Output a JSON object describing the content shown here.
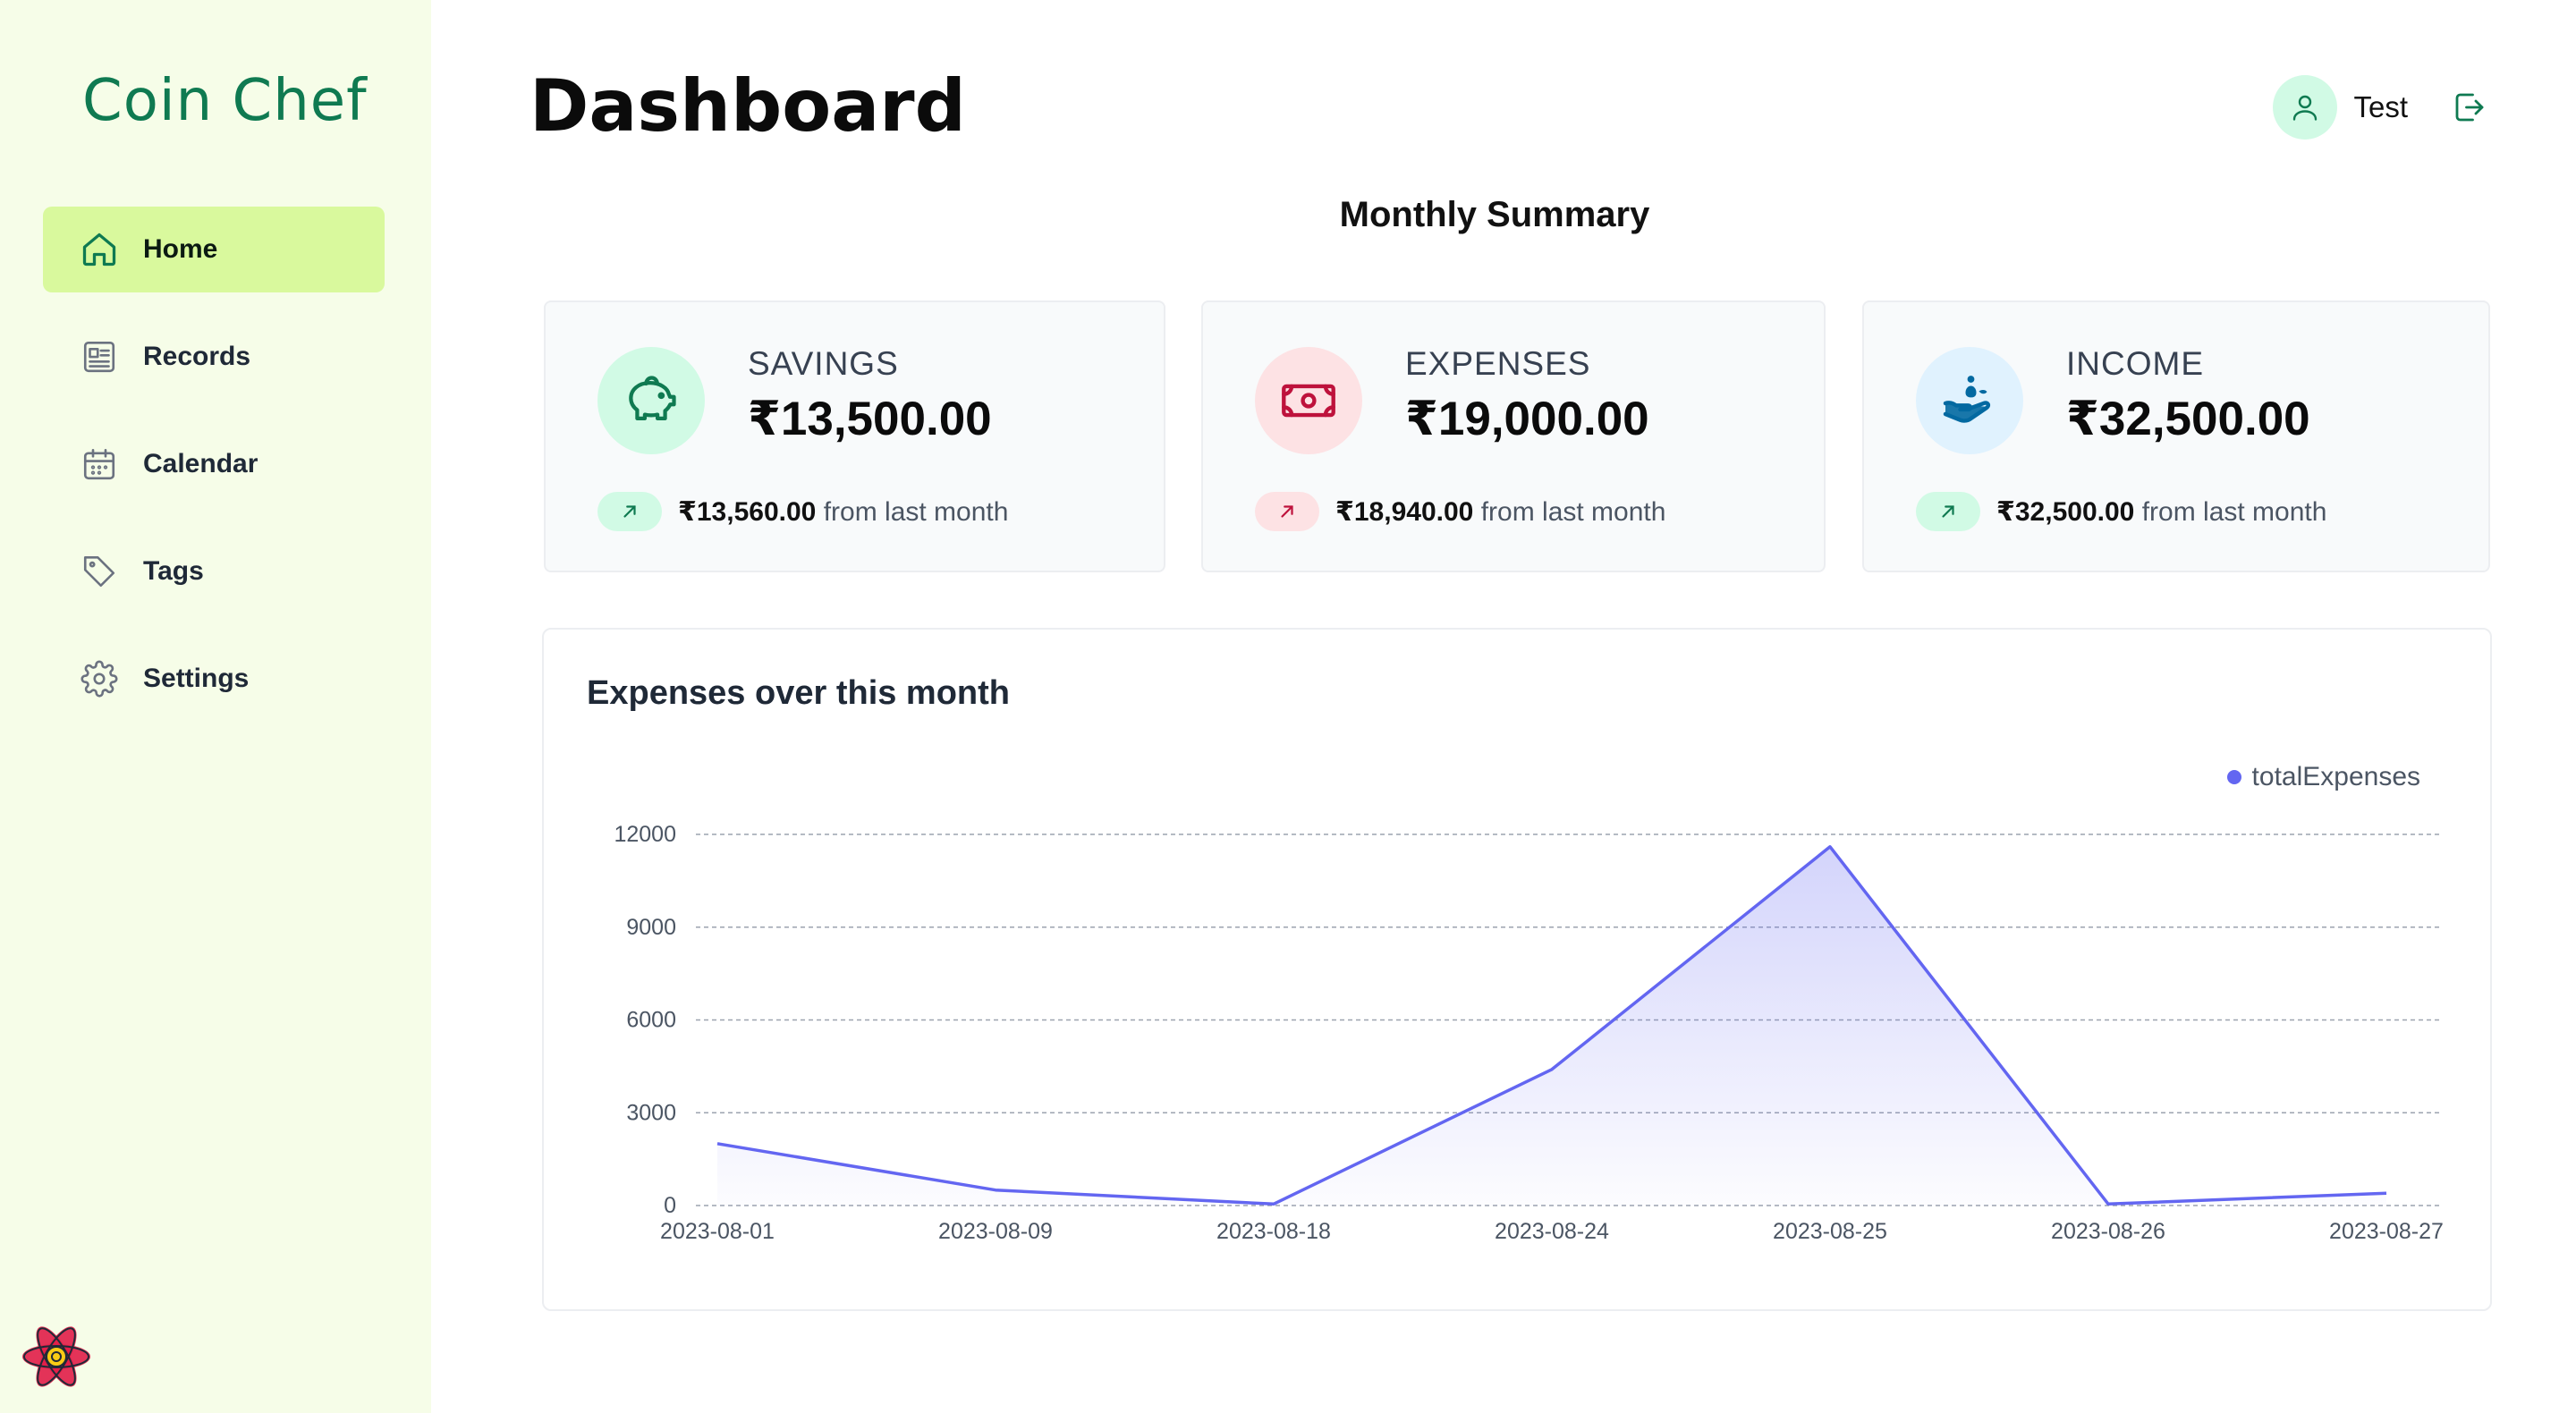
{
  "app": {
    "brand": "Coin Chef"
  },
  "sidebar": {
    "items": [
      {
        "label": "Home",
        "icon": "home-icon",
        "active": true
      },
      {
        "label": "Records",
        "icon": "records-icon",
        "active": false
      },
      {
        "label": "Calendar",
        "icon": "calendar-icon",
        "active": false
      },
      {
        "label": "Tags",
        "icon": "tag-icon",
        "active": false
      },
      {
        "label": "Settings",
        "icon": "gear-icon",
        "active": false
      }
    ]
  },
  "header": {
    "title": "Dashboard",
    "user": {
      "name": "Test",
      "avatar_icon": "user-icon"
    },
    "logout_icon": "logout-icon"
  },
  "summary": {
    "title": "Monthly Summary",
    "cards": [
      {
        "label": "SAVINGS",
        "amount": "₹13,500.00",
        "trend_value": "₹13,560.00",
        "trend_suffix": "from last month",
        "icon": "piggy-bank-icon",
        "accent": "#0f7a51",
        "bg": "#d1fae5"
      },
      {
        "label": "EXPENSES",
        "amount": "₹19,000.00",
        "trend_value": "₹18,940.00",
        "trend_suffix": "from last month",
        "icon": "banknote-icon",
        "accent": "#be123c",
        "bg": "#fde2e4"
      },
      {
        "label": "INCOME",
        "amount": "₹32,500.00",
        "trend_value": "₹32,500.00",
        "trend_suffix": "from last month",
        "icon": "hand-coins-icon",
        "accent": "#0369a1",
        "bg": "#e0f2fe"
      }
    ]
  },
  "colors": {
    "line": "#6366f1",
    "sidebar_bg": "#f6fde8",
    "active_bg": "#d9f99d",
    "brand": "#0f7a51"
  },
  "chart": {
    "title": "Expenses over this month"
  },
  "chart_data": {
    "type": "area",
    "categories": [
      "2023-08-01",
      "2023-08-09",
      "2023-08-18",
      "2023-08-24",
      "2023-08-25",
      "2023-08-26",
      "2023-08-27"
    ],
    "series": [
      {
        "name": "totalExpenses",
        "values": [
          2000,
          500,
          50,
          4400,
          11600,
          50,
          400
        ]
      }
    ],
    "yticks": [
      0,
      3000,
      6000,
      9000,
      12000
    ],
    "ylim": [
      0,
      12000
    ],
    "grid": true,
    "legend": "top-right"
  }
}
